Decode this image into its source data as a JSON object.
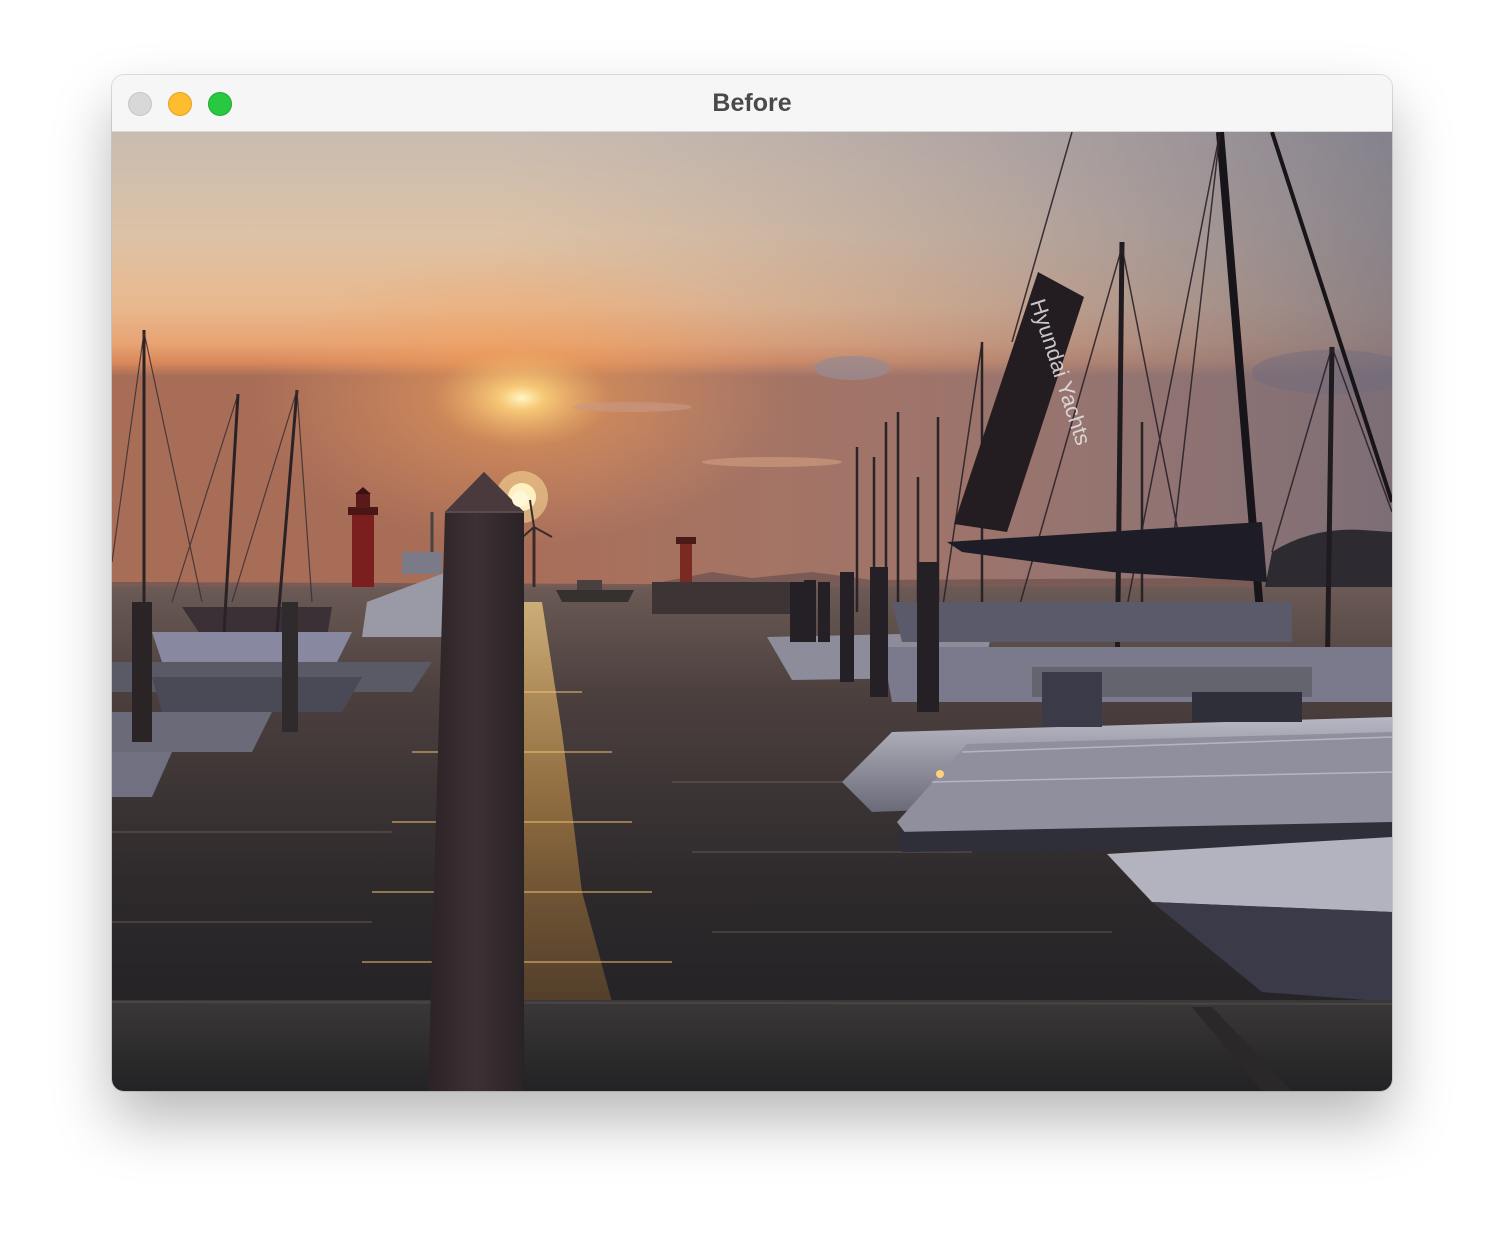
{
  "window": {
    "title": "Before"
  },
  "image": {
    "subject": "Sunset over marina with sailboats and yachts",
    "flag_text": "Hyundai Yachts"
  }
}
